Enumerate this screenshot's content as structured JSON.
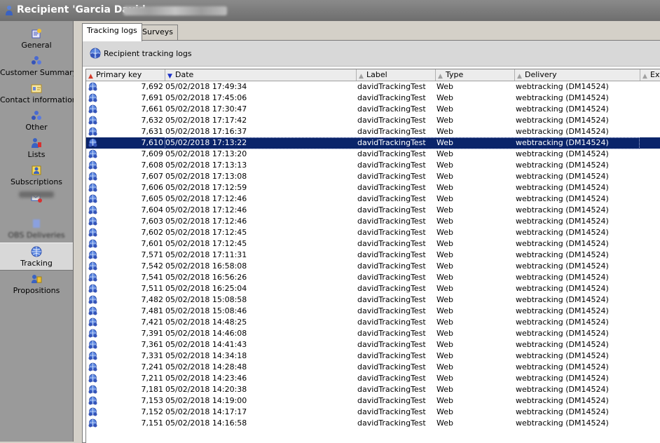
{
  "window": {
    "title": "Recipient 'Garcia David",
    "title_icon": "user-icon"
  },
  "sidebar": {
    "items": [
      {
        "label": "General",
        "icon": "general-icon"
      },
      {
        "label": "Customer Summary",
        "icon": "customer-summary-icon"
      },
      {
        "label": "Contact information",
        "icon": "contact-card-icon"
      },
      {
        "label": "Other",
        "icon": "other-icon"
      },
      {
        "label": "Lists",
        "icon": "lists-icon"
      },
      {
        "label": "Subscriptions",
        "icon": "subscriptions-icon"
      },
      {
        "label": "",
        "icon": "deliveries-icon"
      },
      {
        "label": "OBS Deliveries",
        "icon": "obs-deliveries-icon"
      },
      {
        "label": "Tracking",
        "icon": "tracking-icon",
        "active": true
      },
      {
        "label": "Propositions",
        "icon": "propositions-icon"
      }
    ]
  },
  "tabs": [
    {
      "label": "Tracking logs",
      "active": true
    },
    {
      "label": "Surveys",
      "active": false
    }
  ],
  "panel": {
    "title": "Recipient tracking logs",
    "icon": "tracking-logs-icon"
  },
  "grid": {
    "columns": [
      {
        "label": "Primary key",
        "sort": "asc"
      },
      {
        "label": "Date",
        "sort": "desc"
      },
      {
        "label": "Label",
        "sort": "none"
      },
      {
        "label": "Type",
        "sort": "none"
      },
      {
        "label": "Delivery",
        "sort": "none"
      },
      {
        "label": "Ext",
        "sort": "none"
      }
    ],
    "selected_index": 5,
    "rows": [
      {
        "key": "7,692",
        "date": "05/02/2018 17:49:34",
        "label": "davidTrackingTest",
        "type": "Web",
        "delivery": "webtracking (DM14524)"
      },
      {
        "key": "7,691",
        "date": "05/02/2018 17:45:06",
        "label": "davidTrackingTest",
        "type": "Web",
        "delivery": "webtracking (DM14524)"
      },
      {
        "key": "7,661",
        "date": "05/02/2018 17:30:47",
        "label": "davidTrackingTest",
        "type": "Web",
        "delivery": "webtracking (DM14524)"
      },
      {
        "key": "7,632",
        "date": "05/02/2018 17:17:42",
        "label": "davidTrackingTest",
        "type": "Web",
        "delivery": "webtracking (DM14524)"
      },
      {
        "key": "7,631",
        "date": "05/02/2018 17:16:37",
        "label": "davidTrackingTest",
        "type": "Web",
        "delivery": "webtracking (DM14524)"
      },
      {
        "key": "7,610",
        "date": "05/02/2018 17:13:22",
        "label": "davidTrackingTest",
        "type": "Web",
        "delivery": "webtracking (DM14524)"
      },
      {
        "key": "7,609",
        "date": "05/02/2018 17:13:20",
        "label": "davidTrackingTest",
        "type": "Web",
        "delivery": "webtracking (DM14524)"
      },
      {
        "key": "7,608",
        "date": "05/02/2018 17:13:13",
        "label": "davidTrackingTest",
        "type": "Web",
        "delivery": "webtracking (DM14524)"
      },
      {
        "key": "7,607",
        "date": "05/02/2018 17:13:08",
        "label": "davidTrackingTest",
        "type": "Web",
        "delivery": "webtracking (DM14524)"
      },
      {
        "key": "7,606",
        "date": "05/02/2018 17:12:59",
        "label": "davidTrackingTest",
        "type": "Web",
        "delivery": "webtracking (DM14524)"
      },
      {
        "key": "7,605",
        "date": "05/02/2018 17:12:46",
        "label": "davidTrackingTest",
        "type": "Web",
        "delivery": "webtracking (DM14524)"
      },
      {
        "key": "7,604",
        "date": "05/02/2018 17:12:46",
        "label": "davidTrackingTest",
        "type": "Web",
        "delivery": "webtracking (DM14524)"
      },
      {
        "key": "7,603",
        "date": "05/02/2018 17:12:46",
        "label": "davidTrackingTest",
        "type": "Web",
        "delivery": "webtracking (DM14524)"
      },
      {
        "key": "7,602",
        "date": "05/02/2018 17:12:45",
        "label": "davidTrackingTest",
        "type": "Web",
        "delivery": "webtracking (DM14524)"
      },
      {
        "key": "7,601",
        "date": "05/02/2018 17:12:45",
        "label": "davidTrackingTest",
        "type": "Web",
        "delivery": "webtracking (DM14524)"
      },
      {
        "key": "7,571",
        "date": "05/02/2018 17:11:31",
        "label": "davidTrackingTest",
        "type": "Web",
        "delivery": "webtracking (DM14524)"
      },
      {
        "key": "7,542",
        "date": "05/02/2018 16:58:08",
        "label": "davidTrackingTest",
        "type": "Web",
        "delivery": "webtracking (DM14524)"
      },
      {
        "key": "7,541",
        "date": "05/02/2018 16:56:26",
        "label": "davidTrackingTest",
        "type": "Web",
        "delivery": "webtracking (DM14524)"
      },
      {
        "key": "7,511",
        "date": "05/02/2018 16:25:04",
        "label": "davidTrackingTest",
        "type": "Web",
        "delivery": "webtracking (DM14524)"
      },
      {
        "key": "7,482",
        "date": "05/02/2018 15:08:58",
        "label": "davidTrackingTest",
        "type": "Web",
        "delivery": "webtracking (DM14524)"
      },
      {
        "key": "7,481",
        "date": "05/02/2018 15:08:46",
        "label": "davidTrackingTest",
        "type": "Web",
        "delivery": "webtracking (DM14524)"
      },
      {
        "key": "7,421",
        "date": "05/02/2018 14:48:25",
        "label": "davidTrackingTest",
        "type": "Web",
        "delivery": "webtracking (DM14524)"
      },
      {
        "key": "7,391",
        "date": "05/02/2018 14:46:08",
        "label": "davidTrackingTest",
        "type": "Web",
        "delivery": "webtracking (DM14524)"
      },
      {
        "key": "7,361",
        "date": "05/02/2018 14:41:43",
        "label": "davidTrackingTest",
        "type": "Web",
        "delivery": "webtracking (DM14524)"
      },
      {
        "key": "7,331",
        "date": "05/02/2018 14:34:18",
        "label": "davidTrackingTest",
        "type": "Web",
        "delivery": "webtracking (DM14524)"
      },
      {
        "key": "7,241",
        "date": "05/02/2018 14:28:48",
        "label": "davidTrackingTest",
        "type": "Web",
        "delivery": "webtracking (DM14524)"
      },
      {
        "key": "7,211",
        "date": "05/02/2018 14:23:46",
        "label": "davidTrackingTest",
        "type": "Web",
        "delivery": "webtracking (DM14524)"
      },
      {
        "key": "7,181",
        "date": "05/02/2018 14:20:38",
        "label": "davidTrackingTest",
        "type": "Web",
        "delivery": "webtracking (DM14524)"
      },
      {
        "key": "7,153",
        "date": "05/02/2018 14:19:00",
        "label": "davidTrackingTest",
        "type": "Web",
        "delivery": "webtracking (DM14524)"
      },
      {
        "key": "7,152",
        "date": "05/02/2018 14:17:17",
        "label": "davidTrackingTest",
        "type": "Web",
        "delivery": "webtracking (DM14524)"
      },
      {
        "key": "7,151",
        "date": "05/02/2018 14:16:58",
        "label": "davidTrackingTest",
        "type": "Web",
        "delivery": "webtracking (DM14524)"
      }
    ]
  }
}
